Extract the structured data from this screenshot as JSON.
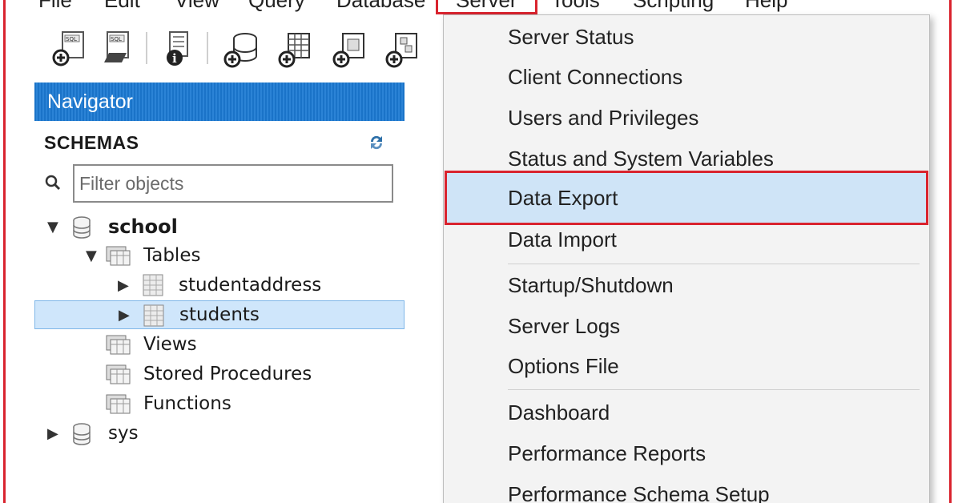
{
  "menubar": {
    "items": [
      "File",
      "Edit",
      "View",
      "Query",
      "Database",
      "Server",
      "Tools",
      "Scripting",
      "Help"
    ]
  },
  "navigator": {
    "title": "Navigator",
    "schemas_label": "SCHEMAS",
    "filter_placeholder": "Filter objects",
    "tree": {
      "school": "school",
      "tables": "Tables",
      "studentaddress": "studentaddress",
      "students": "students",
      "views": "Views",
      "stored_procedures": "Stored Procedures",
      "functions": "Functions",
      "sys": "sys"
    }
  },
  "server_menu": {
    "items": [
      "Server Status",
      "Client Connections",
      "Users and Privileges",
      "Status and System Variables",
      "Data Export",
      "Data Import",
      "Startup/Shutdown",
      "Server Logs",
      "Options File",
      "Dashboard",
      "Performance Reports",
      "Performance Schema Setup"
    ],
    "highlighted": "Data Export"
  },
  "colors": {
    "highlight_red": "#d9232e",
    "navigator_blue": "#1a73c8",
    "selection_blue": "#cfe6fb"
  },
  "icons": [
    "new-sql-tab-icon",
    "open-sql-script-icon",
    "schema-info-icon",
    "create-schema-icon",
    "create-table-icon",
    "create-view-icon",
    "create-procedure-icon",
    "refresh-icon",
    "search-icon",
    "database-icon",
    "folder-icon",
    "table-icon"
  ]
}
